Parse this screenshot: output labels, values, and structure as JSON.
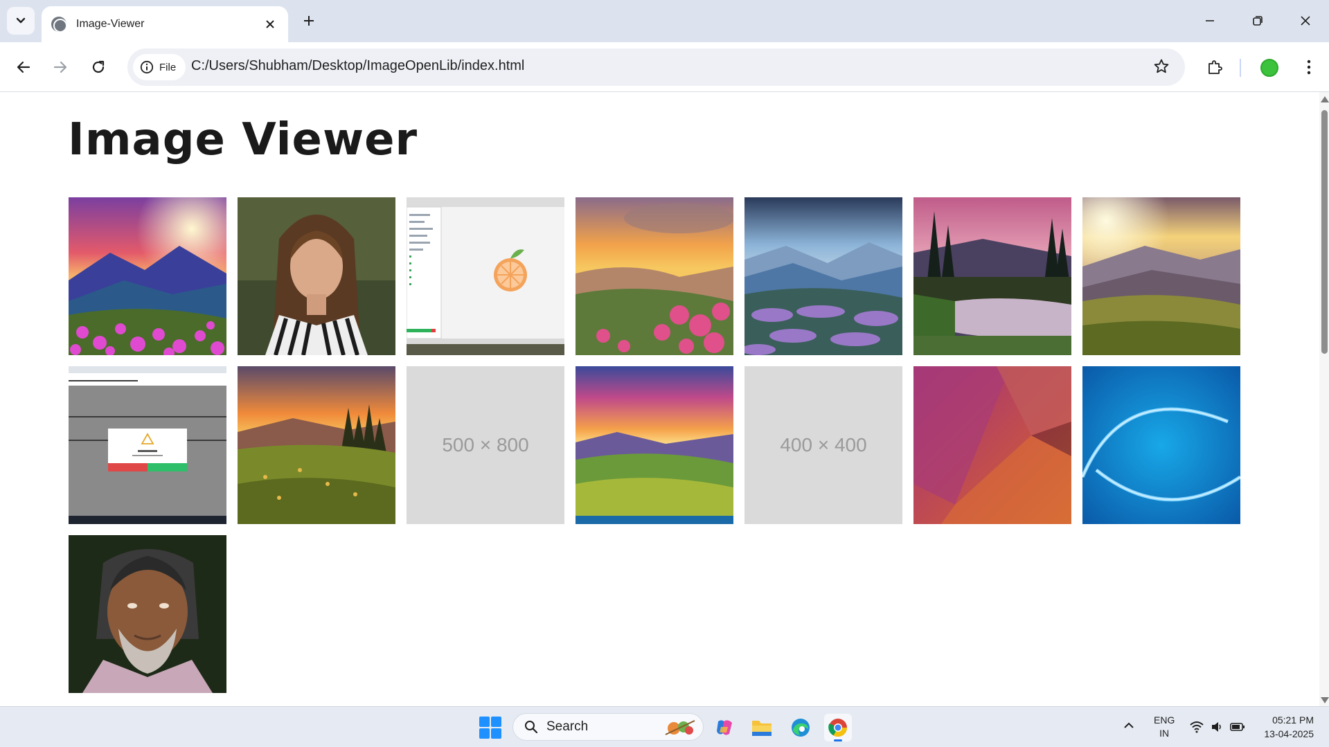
{
  "browser": {
    "tab": {
      "title": "Image-Viewer"
    },
    "address": {
      "chip_label": "File",
      "url": "C:/Users/Shubham/Desktop/ImageOpenLib/index.html"
    },
    "profile_color": "#3cc23c"
  },
  "page": {
    "title": "Image Viewer",
    "images": [
      {
        "kind": "photo",
        "subject": "sunset over mountains with pink flowers"
      },
      {
        "kind": "photo",
        "subject": "portrait of woman in striped shirt"
      },
      {
        "kind": "screenshot",
        "subject": "app window with orange logo"
      },
      {
        "kind": "photo",
        "subject": "sunset valley with pink rhododendrons"
      },
      {
        "kind": "photo",
        "subject": "blue mountain ridges with purple flowers"
      },
      {
        "kind": "photo",
        "subject": "pink sky over forest lake"
      },
      {
        "kind": "photo",
        "subject": "golden light over hills"
      },
      {
        "kind": "screenshot",
        "subject": "confirmation dialog on grey page"
      },
      {
        "kind": "photo",
        "subject": "orange sunset over meadow and pine trees"
      },
      {
        "kind": "placeholder",
        "label": "500 × 800"
      },
      {
        "kind": "photo",
        "subject": "vivid sunset over green hills"
      },
      {
        "kind": "placeholder",
        "label": "400 × 400"
      },
      {
        "kind": "abstract",
        "subject": "magenta to orange layered shapes"
      },
      {
        "kind": "abstract",
        "subject": "blue water ripple eye shape"
      },
      {
        "kind": "photo",
        "subject": "portrait of smiling elderly man"
      }
    ]
  },
  "taskbar": {
    "search_label": "Search",
    "lang_line1": "ENG",
    "lang_line2": "IN",
    "time": "05:21 PM",
    "date": "13-04-2025"
  }
}
